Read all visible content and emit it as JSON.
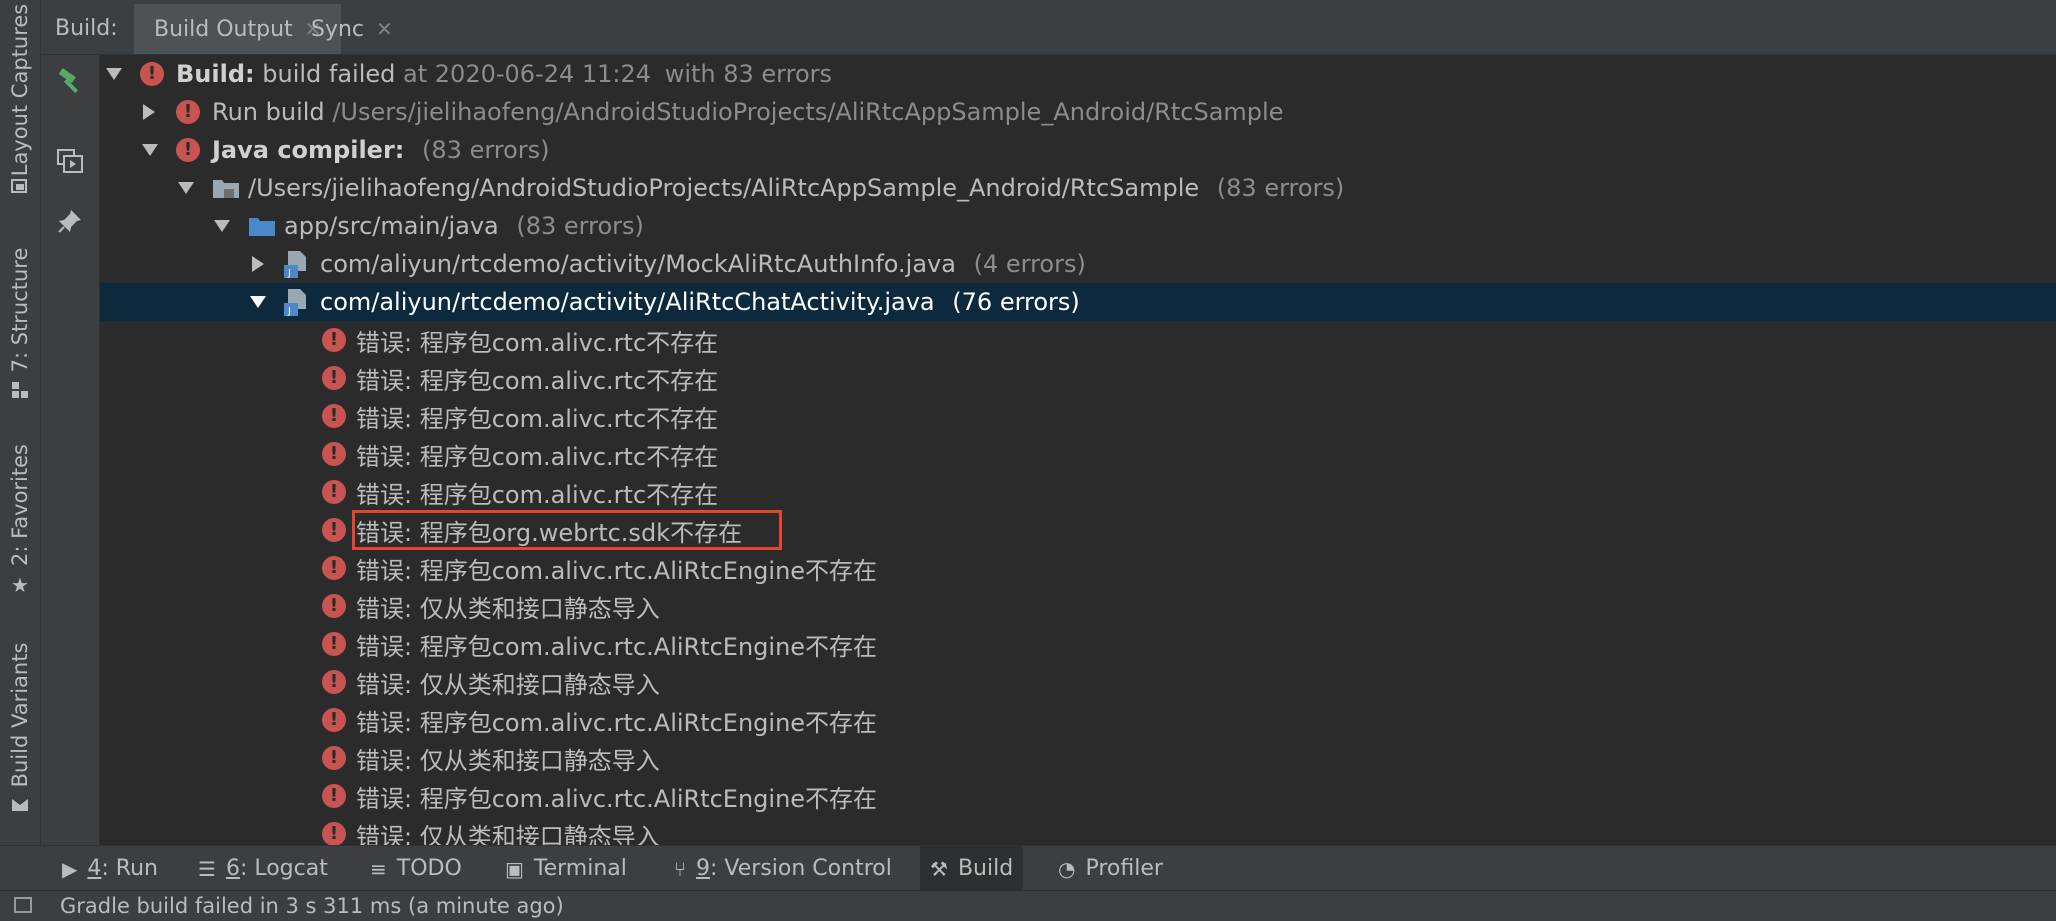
{
  "sidebar": {
    "tabs": [
      {
        "label": "Layout Captures",
        "icon": "layout-captures-icon"
      },
      {
        "label": "7: Structure",
        "icon": "structure-icon"
      },
      {
        "label": "2: Favorites",
        "icon": "star-icon"
      },
      {
        "label": "Build Variants",
        "icon": "build-variants-icon"
      }
    ]
  },
  "header": {
    "caption": "Build:",
    "tabs": [
      {
        "label": "Build Output",
        "active": true
      },
      {
        "label": "Sync",
        "active": false
      }
    ]
  },
  "actions": [
    {
      "icon": "hammer-icon"
    },
    {
      "icon": "toggle-view-icon"
    },
    {
      "icon": "pin-icon"
    }
  ],
  "tree": {
    "root": {
      "label": "Build:",
      "text": "build failed",
      "time": "at 2020-06-24 11:24",
      "count": "with 83 errors"
    },
    "run_build": {
      "label": "Run build",
      "path": "/Users/jielihaofeng/AndroidStudioProjects/AliRtcAppSample_Android/RtcSample"
    },
    "java_compiler": {
      "label": "Java compiler:",
      "count": "(83 errors)"
    },
    "project": {
      "path": "/Users/jielihaofeng/AndroidStudioProjects/AliRtcAppSample_Android/RtcSample",
      "count": "(83 errors)"
    },
    "src": {
      "path": "app/src/main/java",
      "count": "(83 errors)"
    },
    "file1": {
      "path": "com/aliyun/rtcdemo/activity/MockAliRtcAuthInfo.java",
      "count": "(4 errors)"
    },
    "file2": {
      "path": "com/aliyun/rtcdemo/activity/AliRtcChatActivity.java",
      "count": "(76 errors)"
    },
    "errors": [
      "错误: 程序包com.alivc.rtc不存在",
      "错误: 程序包com.alivc.rtc不存在",
      "错误: 程序包com.alivc.rtc不存在",
      "错误: 程序包com.alivc.rtc不存在",
      "错误: 程序包com.alivc.rtc不存在",
      "错误: 程序包org.webrtc.sdk不存在",
      "错误: 程序包com.alivc.rtc.AliRtcEngine不存在",
      "错误: 仅从类和接口静态导入",
      "错误: 程序包com.alivc.rtc.AliRtcEngine不存在",
      "错误: 仅从类和接口静态导入",
      "错误: 程序包com.alivc.rtc.AliRtcEngine不存在",
      "错误: 仅从类和接口静态导入",
      "错误: 程序包com.alivc.rtc.AliRtcEngine不存在",
      "错误: 仅从类和接口静态导入"
    ]
  },
  "bottom_tabs": [
    {
      "mnemonic": "4",
      "label": ": Run",
      "icon": "run-icon"
    },
    {
      "mnemonic": "6",
      "label": ": Logcat",
      "icon": "logcat-icon"
    },
    {
      "mnemonic": "",
      "label": "TODO",
      "icon": "todo-icon"
    },
    {
      "mnemonic": "",
      "label": "Terminal",
      "icon": "terminal-icon"
    },
    {
      "mnemonic": "9",
      "label": ": Version Control",
      "icon": "version-control-icon"
    },
    {
      "mnemonic": "",
      "label": "Build",
      "icon": "hammer-icon",
      "active": true
    },
    {
      "mnemonic": "",
      "label": "Profiler",
      "icon": "profiler-icon"
    }
  ],
  "status": {
    "text": "Gradle build failed in 3 s 311 ms (a minute ago)"
  },
  "colors": {
    "error": "#c75450",
    "selection": "#0d293e",
    "highlight": "#e0472d"
  }
}
